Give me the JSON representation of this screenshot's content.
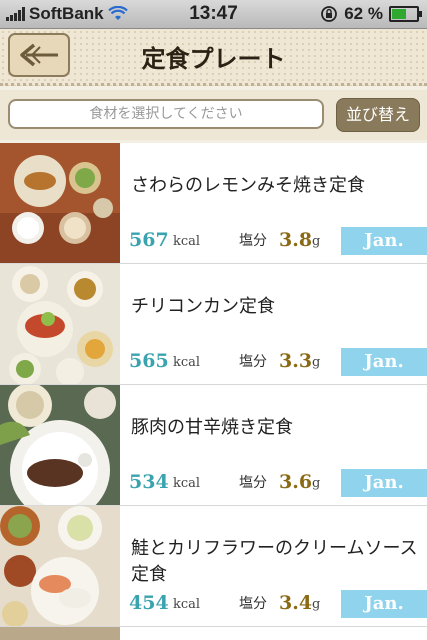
{
  "status_bar": {
    "carrier": "SoftBank",
    "time": "13:47",
    "battery_percent": "62",
    "battery_percent_suffix": "%",
    "battery_level": 0.62
  },
  "header": {
    "title": "定食プレート",
    "back_icon": "back-arrow-icon"
  },
  "search": {
    "placeholder": "食材を選択してください",
    "sort_label": "並び替え"
  },
  "units": {
    "kcal": "kcal",
    "salt_label": "塩分",
    "gram": "g"
  },
  "items": [
    {
      "name": "さわらのレモンみそ焼き定食",
      "kcal": "567",
      "salt": "3.8",
      "month": "Jan."
    },
    {
      "name": "チリコンカン定食",
      "kcal": "565",
      "salt": "3.3",
      "month": "Jan."
    },
    {
      "name": "豚肉の甘辛焼き定食",
      "kcal": "534",
      "salt": "3.6",
      "month": "Jan."
    },
    {
      "name": "鮭とカリフラワーのクリームソース定食",
      "kcal": "454",
      "salt": "3.4",
      "month": "Jan."
    }
  ],
  "colors": {
    "kcal": "#3aa3b0",
    "salt": "#8a6a15",
    "badge": "#8fd3ec",
    "sort_button": "#8a7a5c"
  }
}
